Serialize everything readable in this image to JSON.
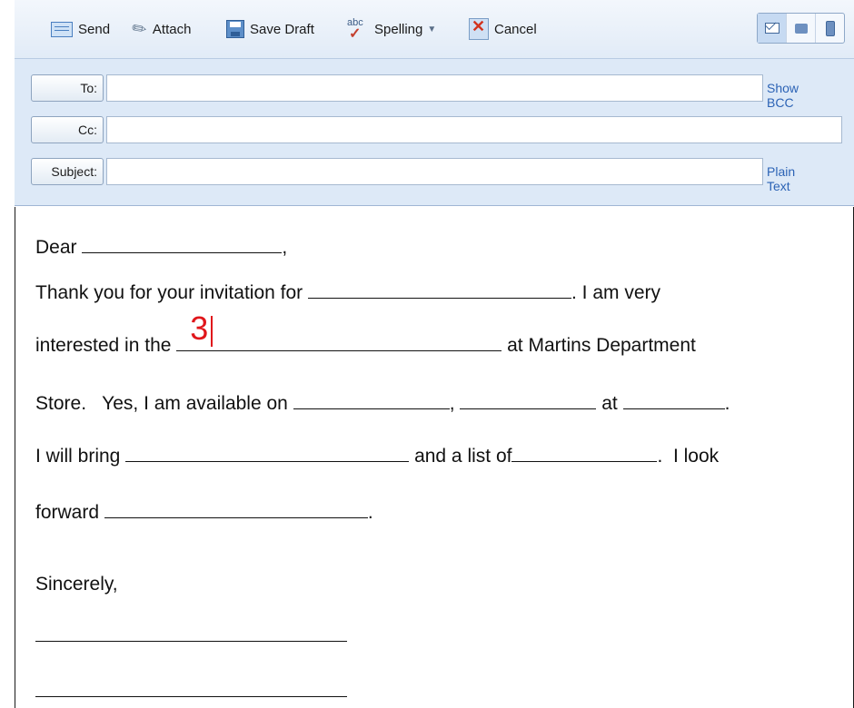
{
  "toolbar": {
    "send": "Send",
    "attach": "Attach",
    "save_draft": "Save Draft",
    "spelling_abc": "abc",
    "spelling": "Spelling",
    "cancel": "Cancel"
  },
  "fields": {
    "to_label": "To:",
    "cc_label": "Cc:",
    "subject_label": "Subject:",
    "show_bcc": "Show BCC",
    "plain_text": "Plain Text"
  },
  "letter": {
    "greeting": "Dear",
    "greeting_end": ",",
    "l1_start": "Thank you for your invitation for",
    "l1_end": ". I am very",
    "l2_start": "interested in the",
    "l2_typed": "3",
    "l2_end": "at Martins Department",
    "l3_start": "Store.   Yes, I am available on",
    "l3_sep1": ",",
    "l3_at": "at",
    "l3_end": ".",
    "l4_start": "I will bring",
    "l4_mid": "and a list of",
    "l4_end": ".  I look",
    "l5_start": "forward",
    "l5_end": ".",
    "closing": "Sincerely,"
  }
}
